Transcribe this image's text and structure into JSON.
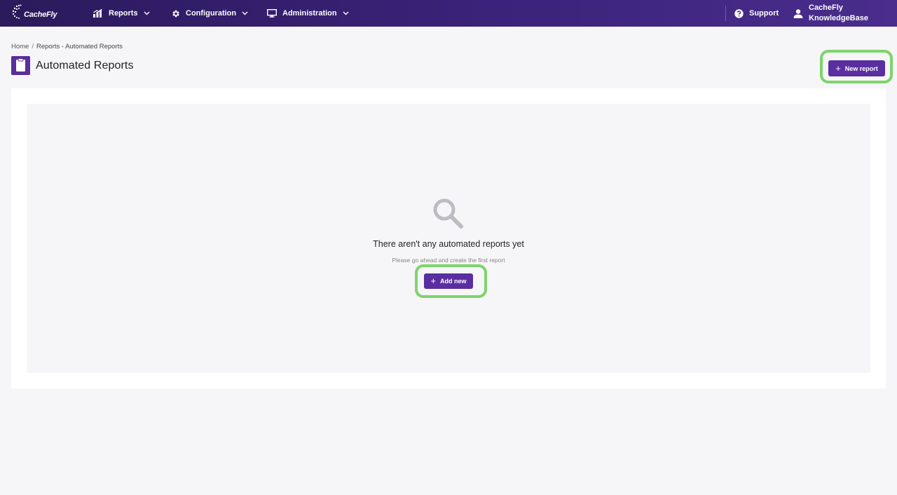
{
  "nav": {
    "logo_text": "CacheFly",
    "reports_label": "Reports",
    "configuration_label": "Configuration",
    "administration_label": "Administration",
    "support_label": "Support",
    "user_line1": "CacheFly",
    "user_line2": "KnowledgeBase"
  },
  "breadcrumb": {
    "home": "Home",
    "separator": "/",
    "current": "Reports - Automated Reports"
  },
  "page": {
    "title": "Automated Reports",
    "new_report_label": "New report"
  },
  "empty_state": {
    "title": "There aren't any automated reports yet",
    "subtitle": "Please go ahead and create the first report",
    "add_new_label": "Add new"
  },
  "colors": {
    "accent": "#5a2ea0",
    "nav_start": "#2b1a5c",
    "nav_end": "#4a2d8c",
    "highlight": "#7ed46b"
  },
  "icons": {
    "reports": "bar-chart-icon",
    "configuration": "gear-icon",
    "administration": "monitor-icon",
    "support": "question-circle-icon",
    "user": "user-icon",
    "empty": "search-icon"
  }
}
